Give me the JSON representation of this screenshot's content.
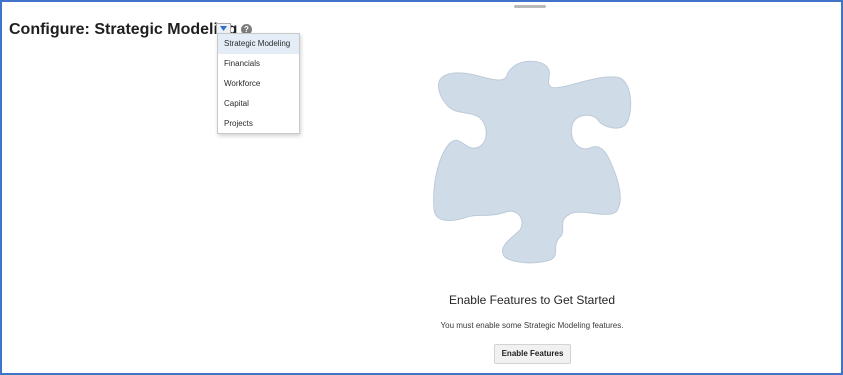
{
  "header": {
    "title": "Configure: Strategic Modeling",
    "help_icon_glyph": "?"
  },
  "dropdown": {
    "icon": "chevron-down-icon",
    "items": [
      {
        "label": "Strategic Modeling",
        "selected": true
      },
      {
        "label": "Financials"
      },
      {
        "label": "Workforce"
      },
      {
        "label": "Capital"
      },
      {
        "label": "Projects"
      }
    ]
  },
  "empty_state": {
    "icon": "puzzle-piece-icon",
    "heading": "Enable Features to Get Started",
    "message": "You must enable some Strategic Modeling features.",
    "button_label": "Enable Features"
  },
  "colors": {
    "frame_border": "#3f74c9",
    "puzzle_fill": "#cfdce8",
    "selected_item_bg": "#e4edf6"
  }
}
